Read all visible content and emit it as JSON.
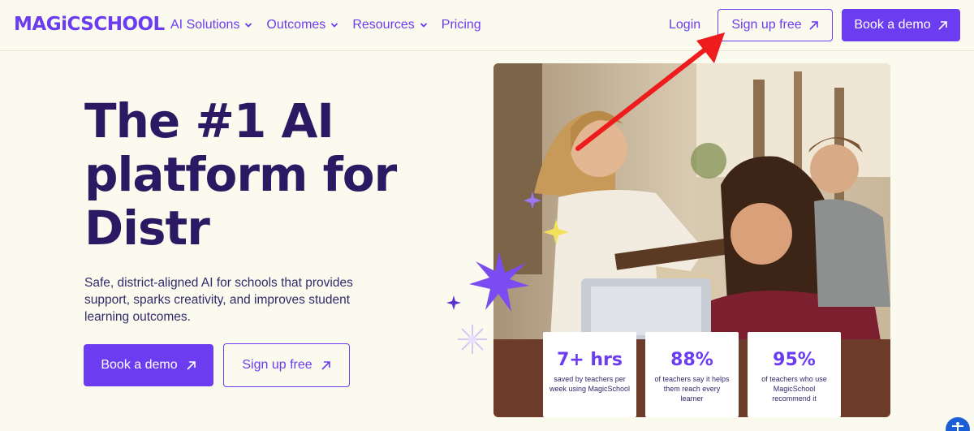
{
  "nav": {
    "logo": "MAGiCSCHOOL",
    "links": [
      {
        "label": "AI Solutions",
        "has_dropdown": true
      },
      {
        "label": "Outcomes",
        "has_dropdown": true
      },
      {
        "label": "Resources",
        "has_dropdown": true
      },
      {
        "label": "Pricing",
        "has_dropdown": false
      }
    ],
    "login": "Login",
    "signup": "Sign up free",
    "demo": "Book a demo"
  },
  "hero": {
    "headline_line1": "The #1 AI",
    "headline_line2": "platform for",
    "headline_line3": "Distr",
    "subtext": "Safe, district-aligned AI for schools that provides support, sparks creativity, and improves student learning outcomes.",
    "demo_button": "Book a demo",
    "signup_button": "Sign up free"
  },
  "stats": [
    {
      "value": "7+ hrs",
      "label": "saved by teachers per week using MagicSchool"
    },
    {
      "value": "88%",
      "label": "of teachers say it helps them reach every learner"
    },
    {
      "value": "95%",
      "label": "of teachers who use MagicSchool recommend it"
    }
  ],
  "colors": {
    "brand": "#6b3cf0",
    "headline": "#2b1a63",
    "background": "#fbfaee",
    "annotation_arrow": "#ee1c1c"
  },
  "icons": {
    "dropdown": "chevron-down-icon",
    "external": "arrow-up-right-icon",
    "accessibility": "accessibility-icon"
  }
}
